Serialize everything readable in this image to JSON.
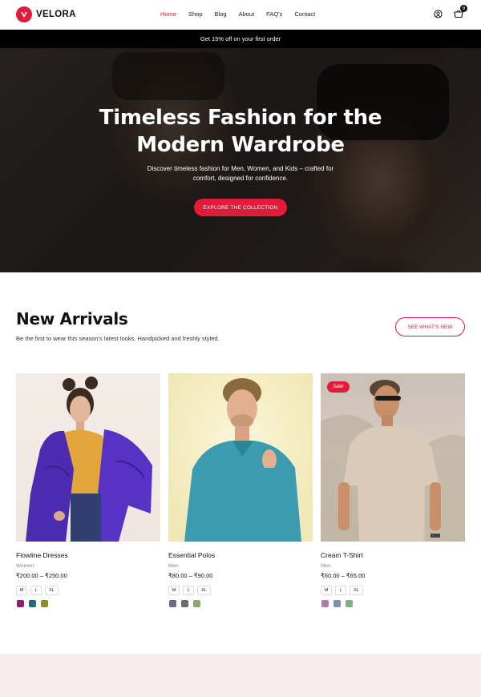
{
  "header": {
    "brand": "VELORA",
    "nav": [
      {
        "label": "Home",
        "active": true
      },
      {
        "label": "Shop",
        "active": false
      },
      {
        "label": "Blog",
        "active": false
      },
      {
        "label": "About",
        "active": false
      },
      {
        "label": "FAQ's",
        "active": false
      },
      {
        "label": "Contact",
        "active": false
      }
    ],
    "icons": [
      "user-icon",
      "cart-icon"
    ],
    "cart_count": "0"
  },
  "promo": {
    "text": "Get 15% off on your first order"
  },
  "hero": {
    "title_line1": "Timeless Fashion for the",
    "title_line2": "Modern Wardrobe",
    "subtitle": "Discover timeless fashion for Men, Women, and Kids – crafted for comfort, designed for confidence.",
    "cta": "EXPLORE THE COLLECTION"
  },
  "new_arrivals": {
    "title": "New Arrivals",
    "subtitle": "Be the first to wear this season's latest looks. Handpicked and freshly styled.",
    "see_all": "SEE WHAT'S NEW",
    "products": [
      {
        "name": "Flowline Dresses",
        "category": "Women",
        "price": "₹200.00 – ₹250.00",
        "sale": "",
        "sizes": [
          "M",
          "L",
          "XL"
        ],
        "swatches": [
          "#8b1e6e",
          "#1f6f7a",
          "#8a8f2a"
        ]
      },
      {
        "name": "Essential Polos",
        "category": "Men",
        "price": "₹80.00 – ₹90.00",
        "sale": "",
        "sizes": [
          "M",
          "L",
          "XL"
        ],
        "swatches": [
          "#6e6a8e",
          "#6a6a6a",
          "#8fa86a"
        ]
      },
      {
        "name": "Cream T-Shirt",
        "category": "Men",
        "price": "₹60.00 – ₹65.00",
        "sale": "Sale!",
        "sizes": [
          "M",
          "L",
          "XL"
        ],
        "swatches": [
          "#b07aa8",
          "#7e8eb0",
          "#7fb08a"
        ]
      }
    ]
  },
  "colors": {
    "accent": "#e31b3b",
    "promo_bg": "#000000",
    "band_bg": "#f7ecec"
  }
}
